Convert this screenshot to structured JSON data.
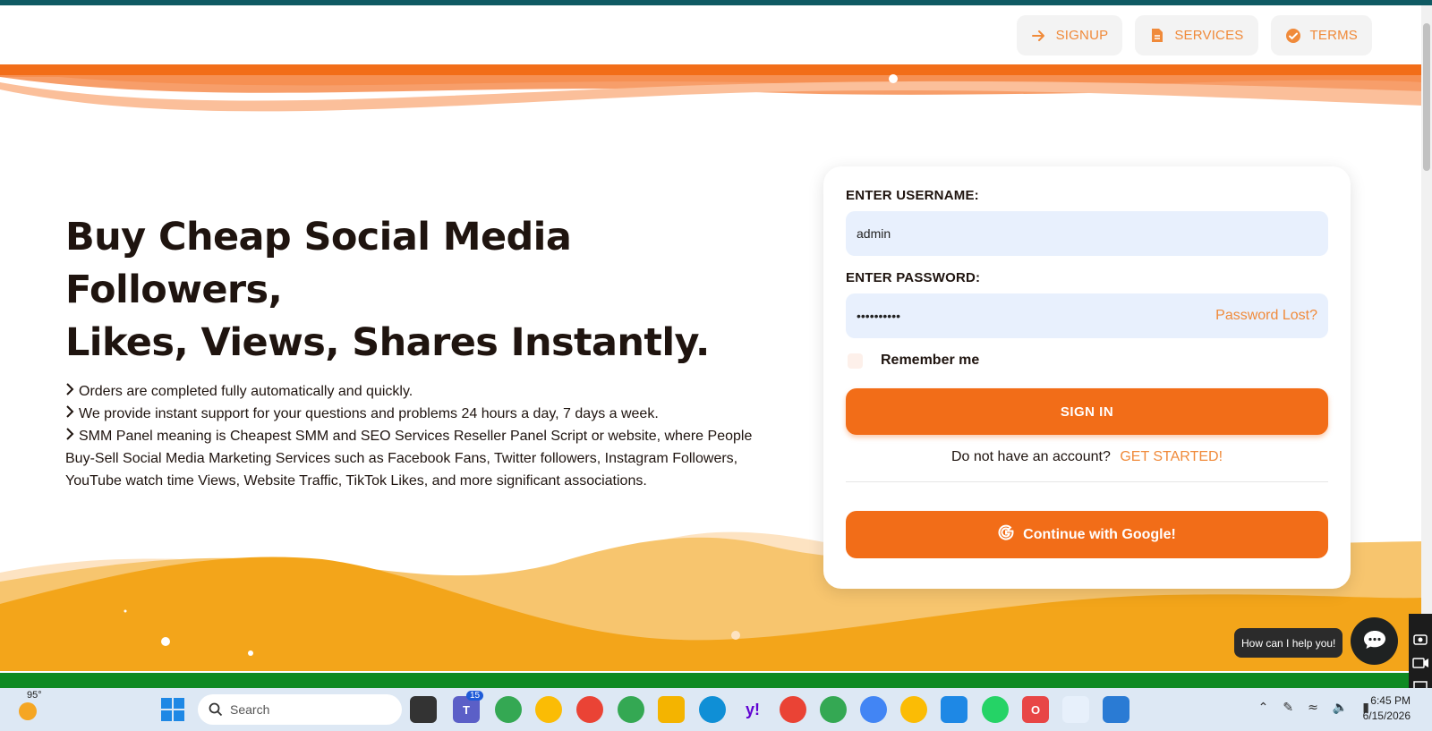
{
  "nav": {
    "signup": "SIGNUP",
    "services": "SERVICES",
    "terms": "TERMS"
  },
  "hero": {
    "title_line1": "Buy Cheap Social Media Followers,",
    "title_line2": "Likes, Views, Shares Instantly.",
    "points": [
      "Orders are completed fully automatically and quickly.",
      "We provide instant support for your questions and problems 24 hours a day, 7 days a week.",
      "SMM Panel meaning is Cheapest SMM and SEO Services Reseller Panel Script or website, where People Buy-Sell Social Media Marketing Services such as Facebook Fans, Twitter followers, Instagram Followers, YouTube watch time Views, Website Traffic, TikTok Likes, and more significant associations."
    ]
  },
  "login": {
    "username_label": "ENTER USERNAME:",
    "username_value": "admin",
    "password_label": "ENTER PASSWORD:",
    "password_value": "••••••••••",
    "password_lost": "Password Lost?",
    "remember_label": "Remember me",
    "signin_label": "SIGN IN",
    "account_text": "Do not have an account?",
    "get_started": "GET STARTED!",
    "google_label": "Continue with Google!"
  },
  "chat": {
    "prompt": "How can I help you!"
  },
  "taskbar": {
    "temperature": "95°",
    "search_placeholder": "Search",
    "teams_badge": "15",
    "time": "6:45 PM",
    "date": "6/15/2026"
  },
  "colors": {
    "accent": "#f26d18",
    "accent_text": "#f08a3a",
    "top_bar": "#0f5a63",
    "green_strip": "#0f8a23",
    "input_bg": "#e8f0fd"
  }
}
